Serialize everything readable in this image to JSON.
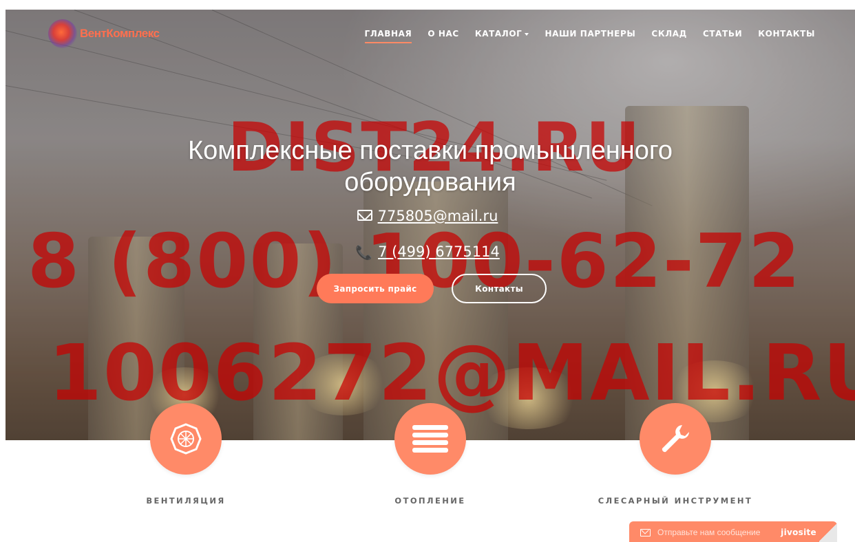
{
  "brand": {
    "logo_text": "ВентКомплекс",
    "logo_icon": "logo-icon"
  },
  "nav": {
    "items": [
      {
        "label": "ГЛАВНАЯ",
        "active": true
      },
      {
        "label": "О НАС"
      },
      {
        "label": "КАТАЛОГ",
        "dropdown": true
      },
      {
        "label": "НАШИ ПАРТНЕРЫ"
      },
      {
        "label": "СКЛАД"
      },
      {
        "label": "СТАТЬИ"
      },
      {
        "label": "КОНТАКТЫ"
      }
    ]
  },
  "watermark": {
    "line1": "DIST24.RU",
    "line2": "8 (800) 100-62-72",
    "line3": "1006272@MAIL.RU"
  },
  "hero": {
    "headline": "Комплексные поставки промышленного оборудования",
    "email": "775805@mail.ru",
    "phone": "7 (499) 6775114",
    "email_icon": "envelope-icon",
    "phone_icon": "phone-icon",
    "btn_primary": "Запросить прайс",
    "btn_secondary": "Контакты"
  },
  "features": [
    {
      "label": "ВЕНТИЛЯЦИЯ",
      "icon": "fan-icon"
    },
    {
      "label": "ОТОПЛЕНИЕ",
      "icon": "radiator-icon"
    },
    {
      "label": "СЛЕСАРНЫЙ ИНСТРУМЕНТ",
      "icon": "wrench-icon"
    }
  ],
  "chat": {
    "message": "Отправьте нам сообщение",
    "brand": "jivosite",
    "icon": "mail-icon"
  },
  "colors": {
    "accent": "#ff8a68",
    "button": "#ff7a59",
    "watermark": "#c80000",
    "label_gray": "#666666"
  }
}
